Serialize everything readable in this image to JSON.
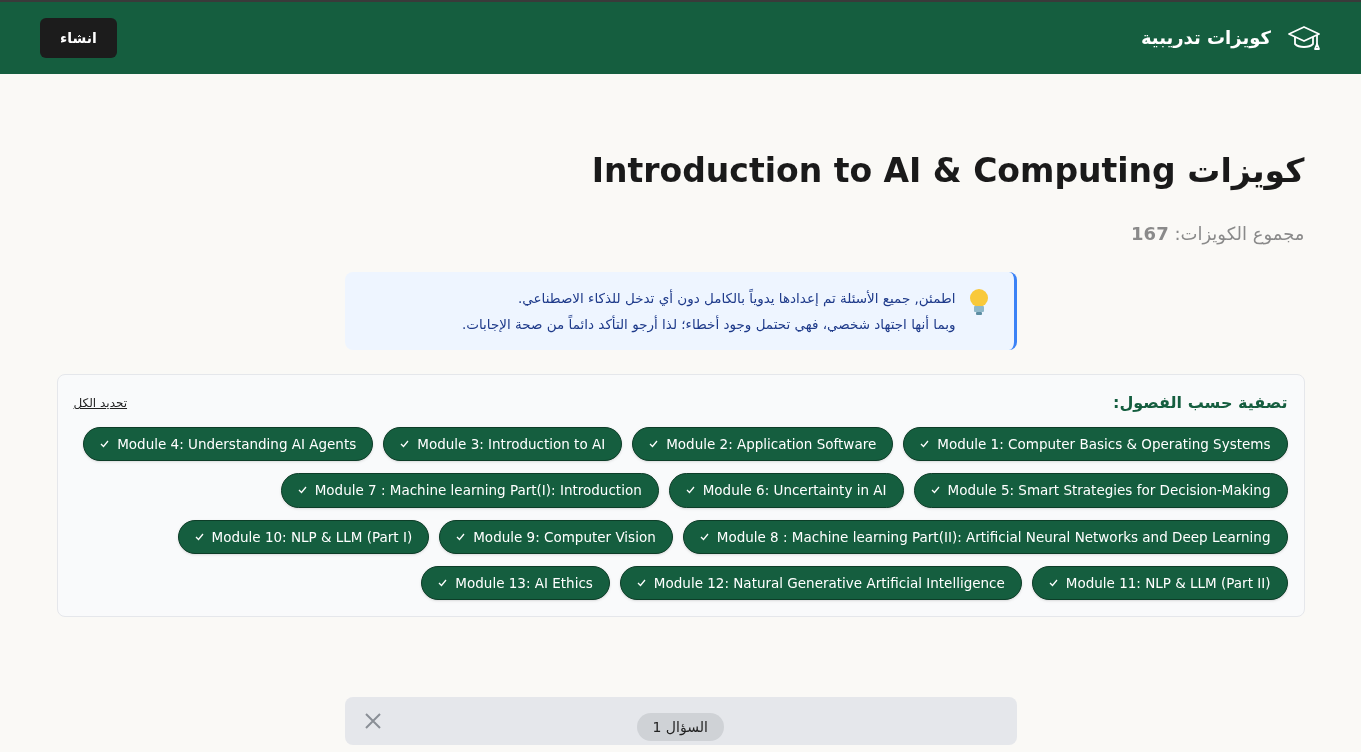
{
  "header": {
    "brand": "كويزات تدريبية",
    "create_button": "انشاء"
  },
  "page": {
    "title": "كويزات Introduction to AI & Computing",
    "total": "مجموع الكويزات: **167**"
  },
  "notice": {
    "lines": [
      "اطمئن, جميع الأسئلة تم إعدادها يدوياً بالكامل دون أي تدخل للذكاء الاصطناعي.",
      "وبما أنها اجتهاد شخصي، فهي تحتمل وجود أخطاء؛ لذا أرجو التأكد دائماً من صحة الإجابات."
    ]
  },
  "filter": {
    "title": "تصفية حسب الفصول:",
    "select_all": "تحديد الكل",
    "modules": [
      {
        "label": "Module 1: Computer Basics & Operating Systems",
        "selected": true
      },
      {
        "label": "Module 2: Application Software",
        "selected": true
      },
      {
        "label": "Module 3: Introduction to AI",
        "selected": true
      },
      {
        "label": "Module 4: Understanding AI Agents",
        "selected": true
      },
      {
        "label": "Module 5: Smart Strategies for Decision-Making",
        "selected": true
      },
      {
        "label": "Module 6: Uncertainty in AI",
        "selected": true
      },
      {
        "label": "Module 7 : Machine learning Part(I): Introduction",
        "selected": true
      },
      {
        "label": "Module 8 : Machine learning Part(II): Artificial Neural Networks and Deep Learning",
        "selected": true
      },
      {
        "label": "Module 9: Computer Vision",
        "selected": true
      },
      {
        "label": "Module 10: NLP & LLM (Part I)",
        "selected": true
      },
      {
        "label": "Module 11: NLP & LLM (Part II)",
        "selected": true
      },
      {
        "label": "Module 12: Natural Generative Artificial Intelligence",
        "selected": true
      },
      {
        "label": "Module 13: AI Ethics",
        "selected": true
      }
    ]
  },
  "question": {
    "badge": "السؤال 1"
  }
}
